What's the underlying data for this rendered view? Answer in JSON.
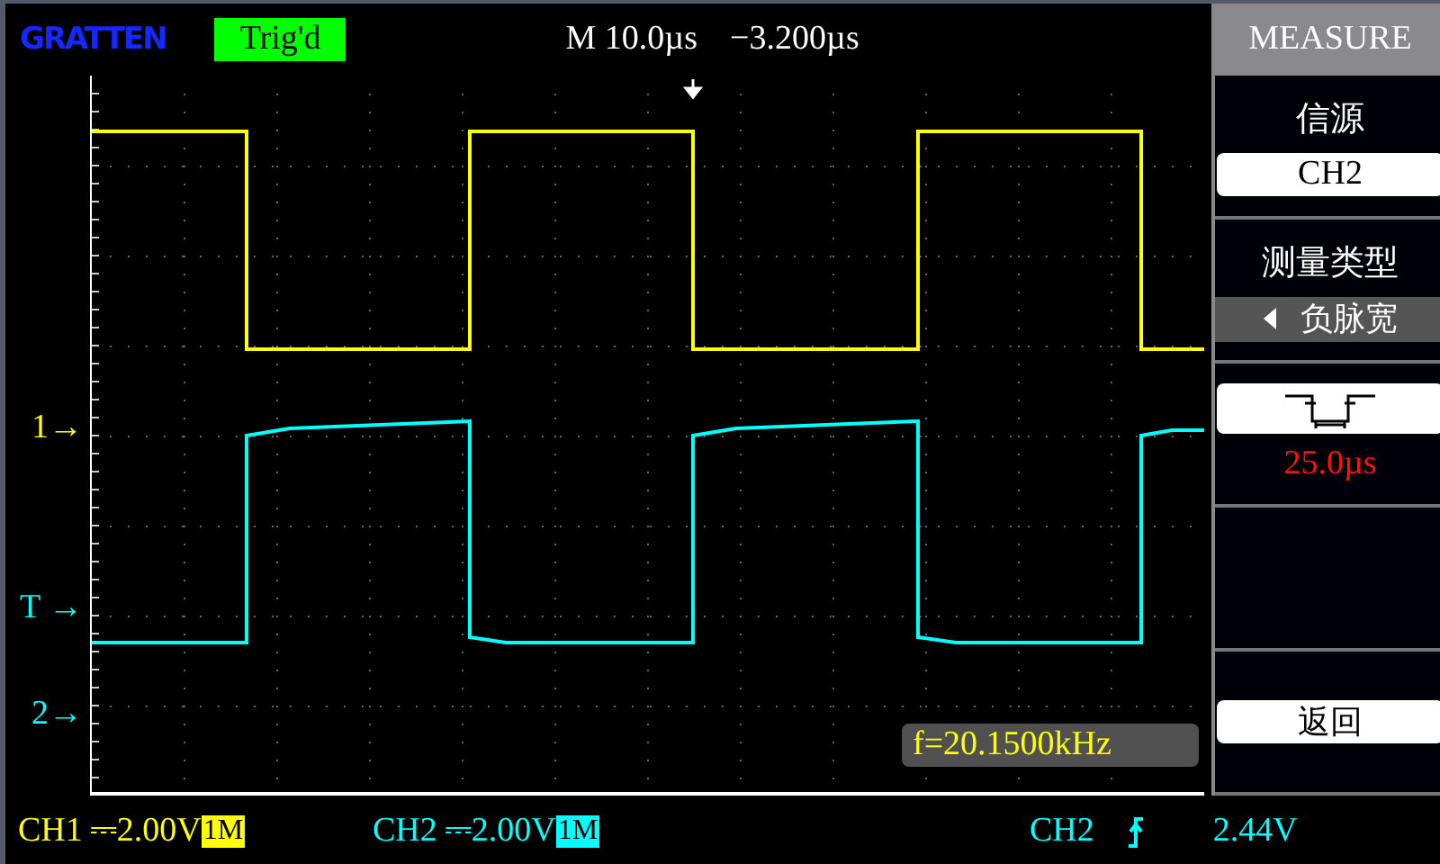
{
  "header": {
    "logo": "GRATTEN",
    "trigger_status": "Trig'd",
    "timebase": "M 10.0µs",
    "trigger_offset": "−3.200µs"
  },
  "markers": [
    {
      "label": "1→",
      "kind": "ch1",
      "color": "#ffff00"
    },
    {
      "label": "T →",
      "kind": "trigger",
      "color": "#00ffff"
    },
    {
      "label": "2→",
      "kind": "ch2",
      "color": "#00ffff"
    }
  ],
  "readout": "f=20.1500kHz",
  "menu": {
    "title": "MEASURE",
    "items": [
      {
        "kind": "option",
        "label": "信源",
        "value": "CH2"
      },
      {
        "kind": "select",
        "label": "测量类型",
        "value": "负脉宽"
      },
      {
        "kind": "graphic",
        "value": "25.0µs"
      },
      {
        "kind": "blank"
      },
      {
        "kind": "button",
        "value": "返回"
      }
    ]
  },
  "status_bar": {
    "channels": [
      {
        "name": "CH1",
        "coupling": "⎓",
        "scale": "2.00V",
        "impedance": "1M",
        "color": "#ffff00"
      },
      {
        "name": "CH2",
        "coupling": "⎓",
        "scale": "2.00V",
        "impedance": "1M",
        "color": "#00ffff"
      }
    ],
    "trigger": {
      "source": "CH2",
      "level": "2.44V"
    }
  }
}
